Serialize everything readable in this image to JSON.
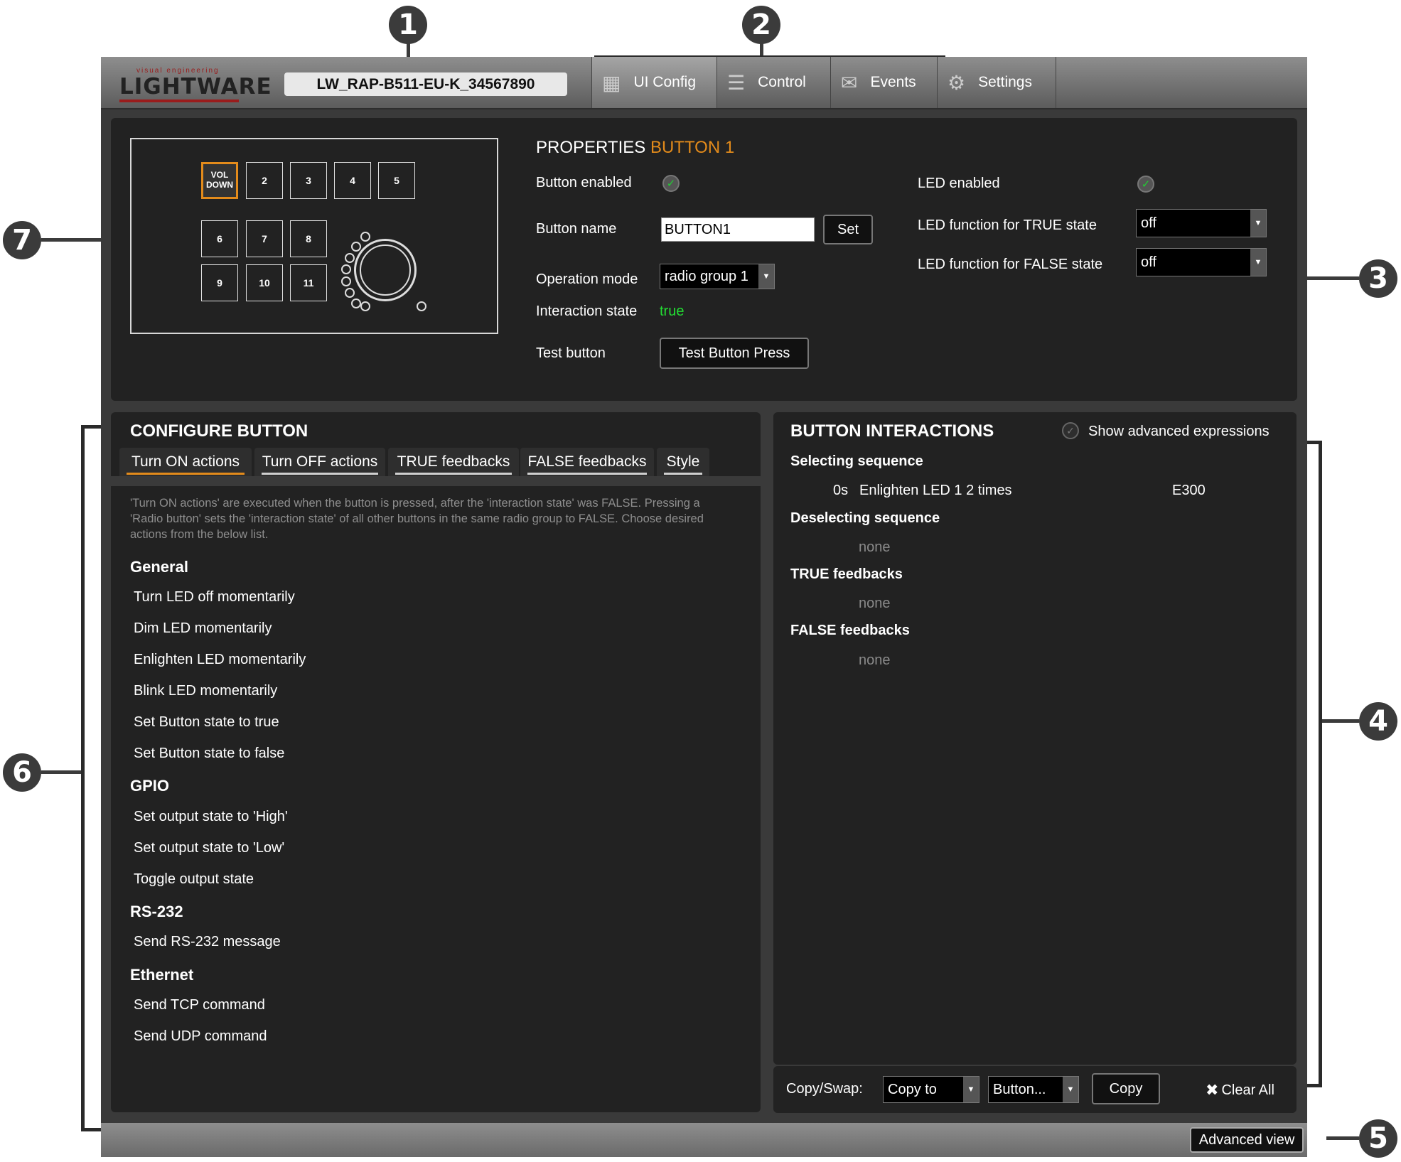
{
  "callouts": [
    "1",
    "2",
    "3",
    "4",
    "5",
    "6",
    "7"
  ],
  "brand": {
    "tagline": "visual engineering",
    "name": "LIGHTWARE"
  },
  "device_name": "LW_RAP-B511-EU-K_34567890",
  "tabs": [
    {
      "label": "UI Config",
      "icon": "grid-icon"
    },
    {
      "label": "Control",
      "icon": "sliders-icon"
    },
    {
      "label": "Events",
      "icon": "events-icon"
    },
    {
      "label": "Settings",
      "icon": "gear-icon"
    }
  ],
  "keypad": {
    "row1": [
      "VOL DOWN",
      "2",
      "3",
      "4",
      "5"
    ],
    "row2": [
      "6",
      "7",
      "8"
    ],
    "row3": [
      "9",
      "10",
      "11"
    ]
  },
  "properties": {
    "title": "PROPERTIES",
    "selected": "BUTTON 1",
    "button_enabled_label": "Button enabled",
    "button_name_label": "Button name",
    "button_name_value": "BUTTON1",
    "set_label": "Set",
    "operation_mode_label": "Operation mode",
    "operation_mode_value": "radio group 1",
    "interaction_state_label": "Interaction state",
    "interaction_state_value": "true",
    "test_button_label": "Test button",
    "test_button_press": "Test Button Press",
    "led_enabled_label": "LED enabled",
    "led_true_label": "LED function for TRUE state",
    "led_true_value": "off",
    "led_false_label": "LED function for FALSE state",
    "led_false_value": "off"
  },
  "configure": {
    "title": "CONFIGURE BUTTON",
    "tabs": [
      "Turn ON actions",
      "Turn OFF actions",
      "TRUE feedbacks",
      "FALSE feedbacks",
      "Style"
    ],
    "description": "'Turn ON actions' are executed when the button is pressed, after the 'interaction state' was FALSE. Pressing a 'Radio button' sets the 'interaction state' of all other buttons in the same radio group to FALSE. Choose desired actions from the below list.",
    "sections": [
      {
        "title": "General",
        "items": [
          "Turn LED off momentarily",
          "Dim LED momentarily",
          "Enlighten LED momentarily",
          "Blink LED momentarily",
          "Set Button state to true",
          "Set Button state to false"
        ]
      },
      {
        "title": "GPIO",
        "items": [
          "Set output state to 'High'",
          "Set output state to 'Low'",
          "Toggle output state"
        ]
      },
      {
        "title": "RS-232",
        "items": [
          "Send RS-232 message"
        ]
      },
      {
        "title": "Ethernet",
        "items": [
          "Send TCP command",
          "Send UDP command"
        ]
      }
    ]
  },
  "interactions": {
    "title": "BUTTON INTERACTIONS",
    "show_advanced": "Show advanced expressions",
    "selecting_title": "Selecting sequence",
    "selecting_time": "0s",
    "selecting_action": "Enlighten LED 1 2 times",
    "selecting_code": "E300",
    "deselecting_title": "Deselecting sequence",
    "deselecting_value": "none",
    "true_title": "TRUE feedbacks",
    "true_value": "none",
    "false_title": "FALSE feedbacks",
    "false_value": "none"
  },
  "copy_bar": {
    "label": "Copy/Swap:",
    "mode": "Copy to",
    "target": "Button...",
    "copy_button": "Copy",
    "clear_all": "Clear All"
  },
  "advanced_view": "Advanced view",
  "colors": {
    "accent": "#e38b1b",
    "true_green": "#22dd33",
    "panel": "#222222",
    "background": "#3a3a3a"
  }
}
